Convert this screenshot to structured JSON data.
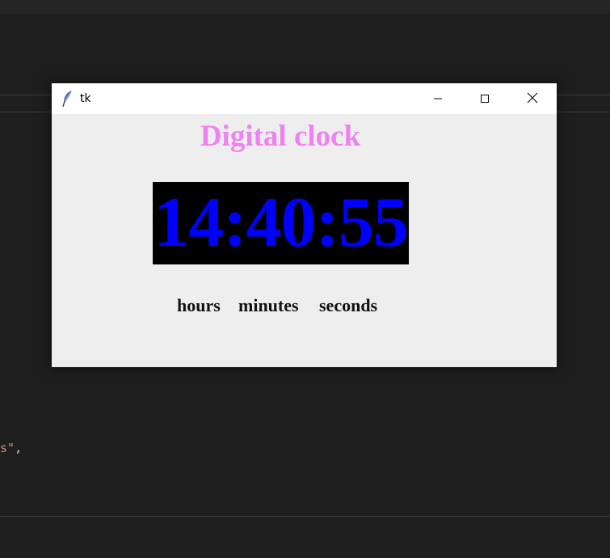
{
  "editor": {
    "code_fragment_string": "s\"",
    "code_fragment_punct": ","
  },
  "window": {
    "title": "tk",
    "app_icon": "feather-icon",
    "controls": {
      "minimize_icon": "minimize-icon",
      "maximize_icon": "maximize-icon",
      "close_icon": "close-icon"
    }
  },
  "app": {
    "heading": "Digital clock",
    "time": "14:40:55",
    "labels": {
      "hours": "hours",
      "minutes": "minutes",
      "seconds": "seconds"
    }
  },
  "colors": {
    "heading": "#ee82ee",
    "clock_text": "#0000ff",
    "clock_background": "#000000",
    "window_background": "#efeeef",
    "desktop_background": "#1e1e1e"
  }
}
